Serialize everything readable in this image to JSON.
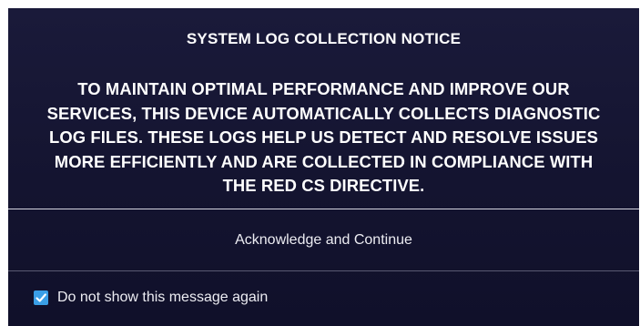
{
  "dialog": {
    "title": "SYSTEM LOG COLLECTION NOTICE",
    "message_lines": [
      "TO MAINTAIN OPTIMAL PERFORMANCE AND IMPROVE OUR",
      "SERVICES, THIS DEVICE AUTOMATICALLY COLLECTS DIAGNOSTIC",
      "LOG FILES. THESE LOGS HELP US DETECT AND RESOLVE ISSUES",
      "MORE EFFICIENTLY AND ARE COLLECTED IN COMPLIANCE WITH",
      "THE RED CS DIRECTIVE."
    ],
    "acknowledge_label": "Acknowledge and Continue",
    "dont_show_label": "Do not show this message again",
    "dont_show_checked": true,
    "checkbox_icon": "check-icon"
  },
  "colors": {
    "background": "#16163a",
    "text": "#ffffff",
    "checkbox_accent": "#3a9ee6"
  }
}
